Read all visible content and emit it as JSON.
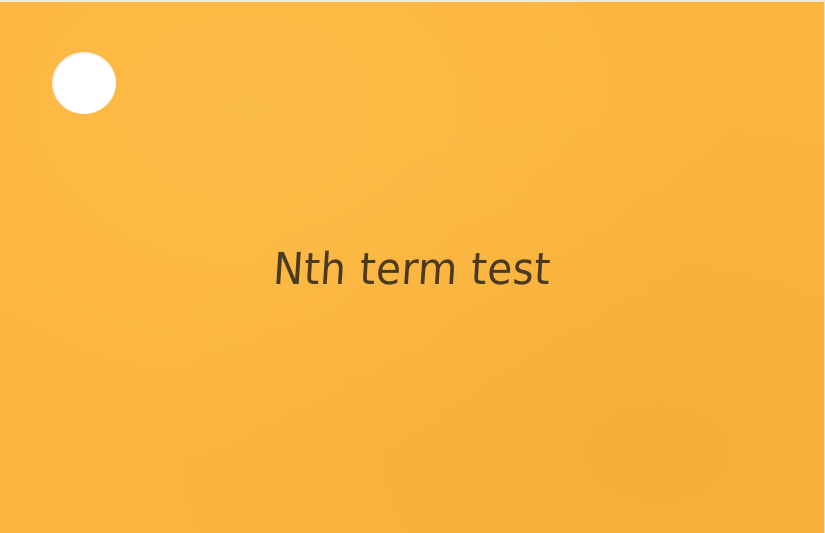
{
  "card": {
    "title": "Nth term test",
    "background_color": "#fbb53e",
    "text_color": "#4a3a22"
  }
}
